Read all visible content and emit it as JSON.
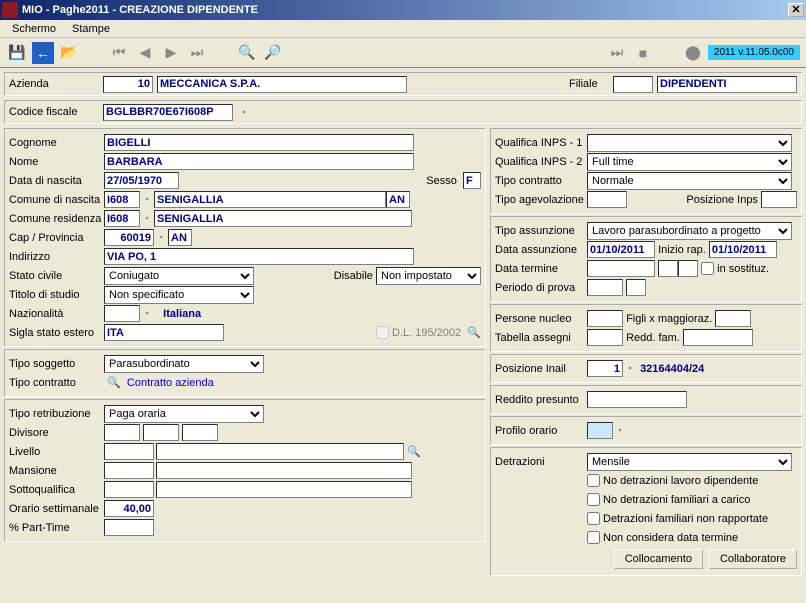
{
  "window": {
    "title": "MIO - Paghe2011 - CREAZIONE DIPENDENTE"
  },
  "menu": {
    "schermo": "Schermo",
    "stampe": "Stampe"
  },
  "toolbar": {
    "version": "2011 v.11.05.0c00"
  },
  "azienda": {
    "label": "Azienda",
    "code": "10",
    "name": "MECCANICA S.P.A."
  },
  "filiale": {
    "label": "Filiale",
    "code": "",
    "name": "DIPENDENTI"
  },
  "codfisc": {
    "label": "Codice fiscale",
    "value": "BGLBBR70E67I608P"
  },
  "left1": {
    "cognome_lbl": "Cognome",
    "cognome": "BIGELLI",
    "nome_lbl": "Nome",
    "nome": "BARBARA",
    "datanasc_lbl": "Data di nascita",
    "datanasc": "27/05/1970",
    "sesso_lbl": "Sesso",
    "sesso": "F",
    "comnasc_lbl": "Comune di nascita",
    "comnasc_code": "I608",
    "comnasc_name": "SENIGALLIA",
    "comnasc_prov": "AN",
    "comres_lbl": "Comune residenza",
    "comres_code": "I608",
    "comres_name": "SENIGALLIA",
    "cap_lbl": "Cap / Provincia",
    "cap": "60019",
    "prov": "AN",
    "ind_lbl": "Indirizzo",
    "ind": "VIA PO, 1",
    "statociv_lbl": "Stato civile",
    "statociv": "Coniugato",
    "disabile_lbl": "Disabile",
    "disabile": "Non impostato",
    "titstud_lbl": "Titolo di studio",
    "titstud": "Non specificato",
    "naz_lbl": "Nazionalità",
    "naz_code": "",
    "naz_name": "Italiana",
    "sigla_lbl": "Sigla stato estero",
    "sigla": "ITA",
    "dl195_lbl": "D.L. 195/2002"
  },
  "left2": {
    "tiposog_lbl": "Tipo soggetto",
    "tiposog": "Parasubordinato",
    "tipocon_lbl": "Tipo contratto",
    "tipocon_link": "Contratto azienda"
  },
  "left3": {
    "tiporet_lbl": "Tipo retribuzione",
    "tiporet": "Paga oraria",
    "div_lbl": "Divisore",
    "liv_lbl": "Livello",
    "mans_lbl": "Mansione",
    "sqf_lbl": "Sottoqualifica",
    "orario_lbl": "Orario settimanale",
    "orario": "40,00",
    "pt_lbl": "% Part-Time"
  },
  "right1": {
    "qinps1_lbl": "Qualifica INPS - 1",
    "qinps1": "",
    "qinps2_lbl": "Qualifica INPS - 2",
    "qinps2": "Full time",
    "tcontr_lbl": "Tipo contratto",
    "tcontr": "Normale",
    "tagev_lbl": "Tipo agevolazione",
    "posinps_lbl": "Posizione Inps"
  },
  "right2": {
    "tass_lbl": "Tipo assunzione",
    "tass": "Lavoro parasubordinato a progetto",
    "dass_lbl": "Data assunzione",
    "dass": "01/10/2011",
    "inizrap_lbl": "Inizio rap.",
    "inizrap": "01/10/2011",
    "dterm_lbl": "Data termine",
    "insost_lbl": "in sostituz.",
    "pprova_lbl": "Periodo di prova"
  },
  "right3": {
    "pnuc_lbl": "Persone nucleo",
    "figli_lbl": "Figli x maggioraz.",
    "tass_lbl": "Tabella assegni",
    "redd_lbl": "Redd. fam."
  },
  "right4": {
    "pinail_lbl": "Posizione Inail",
    "pinail_num": "1",
    "pinail_code": "32164404/24"
  },
  "right5": {
    "redpres_lbl": "Reddito presunto"
  },
  "right6": {
    "prof_lbl": "Profilo orario"
  },
  "right7": {
    "detr_lbl": "Detrazioni",
    "detr": "Mensile",
    "opt1": "No detrazioni lavoro dipendente",
    "opt2": "No detrazioni familiari a carico",
    "opt3": "Detrazioni familiari non rapportate",
    "opt4": "Non considera data termine",
    "btn_coll": "Collocamento",
    "btn_collab": "Collaboratore"
  }
}
